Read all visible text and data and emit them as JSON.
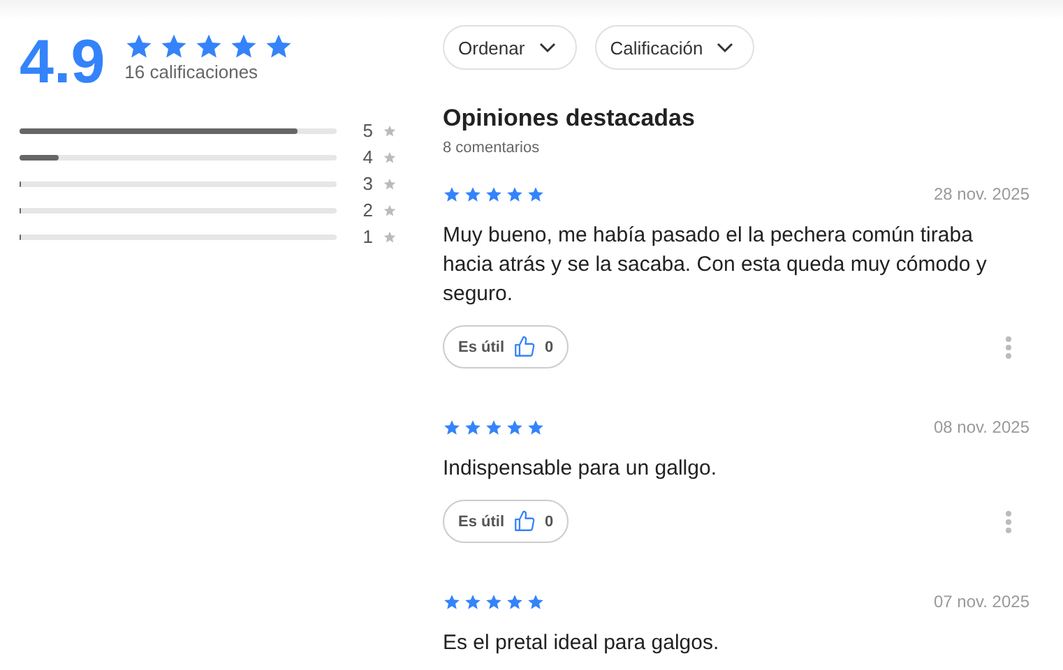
{
  "summary": {
    "average": "4.9",
    "stars": 5,
    "count": "16 calificaciones"
  },
  "distribution": [
    {
      "label": "5",
      "level": 0.875
    },
    {
      "label": "4",
      "level": 0.125
    },
    {
      "label": "3",
      "level": 0
    },
    {
      "label": "2",
      "level": 0
    },
    {
      "label": "1",
      "level": 0
    }
  ],
  "filters": [
    "Ordenar",
    "Calificación"
  ],
  "reviews_header": {
    "title": "Opiniones destacadas",
    "count": "8 comentarios"
  },
  "reviews": [
    {
      "stars": 5,
      "date": "28 nov. 2025",
      "text": "Muy bueno, me había pasado el la pechera común tiraba hacia atrás y se la sacaba. Con esta queda muy cómodo y seguro.",
      "helpful_label": "Es útil",
      "helpful_count": "0"
    },
    {
      "stars": 5,
      "date": "08 nov. 2025",
      "text": "Indispensable para un gallgo.",
      "helpful_label": "Es útil",
      "helpful_count": "0"
    },
    {
      "stars": 5,
      "date": "07 nov. 2025",
      "text": "Es el pretal ideal para galgos."
    }
  ]
}
